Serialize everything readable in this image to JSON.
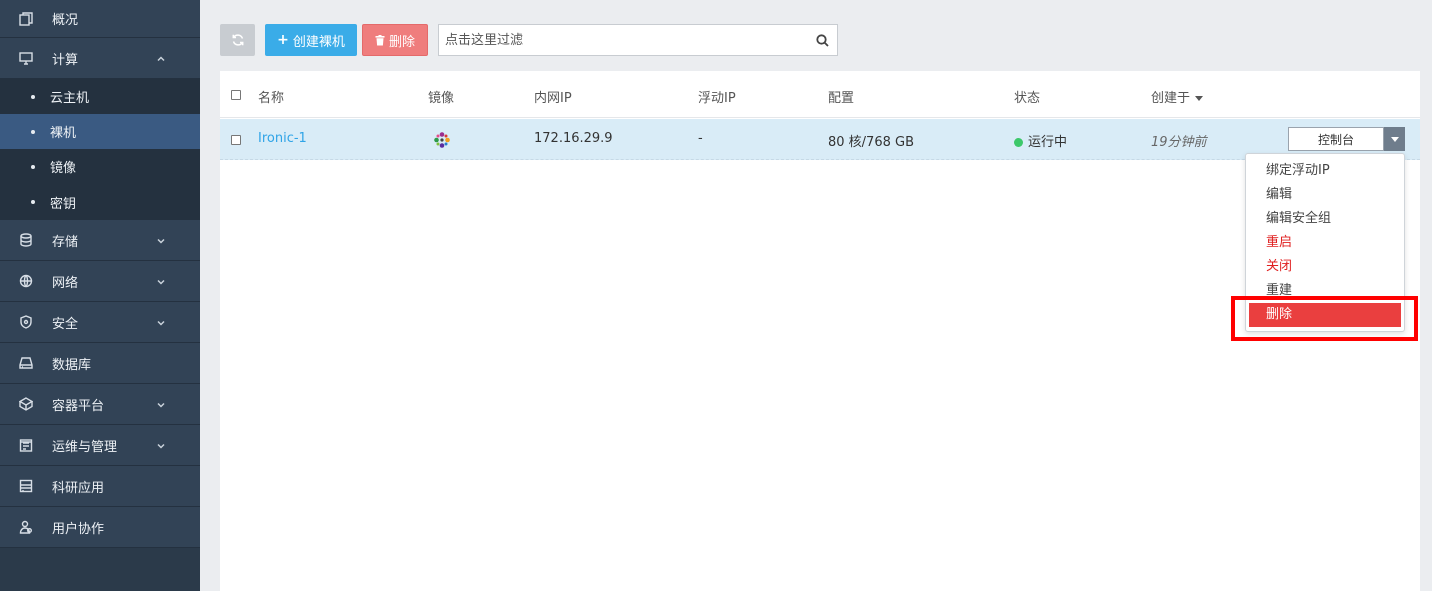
{
  "sidebar": {
    "overview": "概况",
    "compute": "计算",
    "compute_children": [
      "云主机",
      "裸机",
      "镜像",
      "密钥"
    ],
    "storage": "存储",
    "network": "网络",
    "security": "安全",
    "database": "数据库",
    "container": "容器平台",
    "ops": "运维与管理",
    "research": "科研应用",
    "collab": "用户协作"
  },
  "toolbar": {
    "create_label": "创建裸机",
    "delete_label": "删除",
    "search_placeholder": "点击这里过滤"
  },
  "table": {
    "headers": {
      "name": "名称",
      "image": "镜像",
      "internal_ip": "内网IP",
      "floating_ip": "浮动IP",
      "config": "配置",
      "status": "状态",
      "created": "创建于"
    },
    "rows": [
      {
        "name": "Ironic-1",
        "image_icon": "os-logo-icon",
        "internal_ip": "172.16.29.9",
        "floating_ip": "-",
        "config": "80 核/768 GB",
        "status": "运行中",
        "created": "19分钟前",
        "action": "控制台"
      }
    ]
  },
  "dropdown": {
    "items": [
      "绑定浮动IP",
      "编辑",
      "编辑安全组",
      "重启",
      "关闭",
      "重建",
      "删除"
    ]
  },
  "colors": {
    "sidebar_bg": "#2b3a4a",
    "active_nav": "#3a5a82",
    "primary": "#3aace8",
    "danger": "#ef7d7d",
    "row_selected": "#d9ecf7",
    "status_running": "#3cc86a",
    "highlight": "#ff0000"
  }
}
